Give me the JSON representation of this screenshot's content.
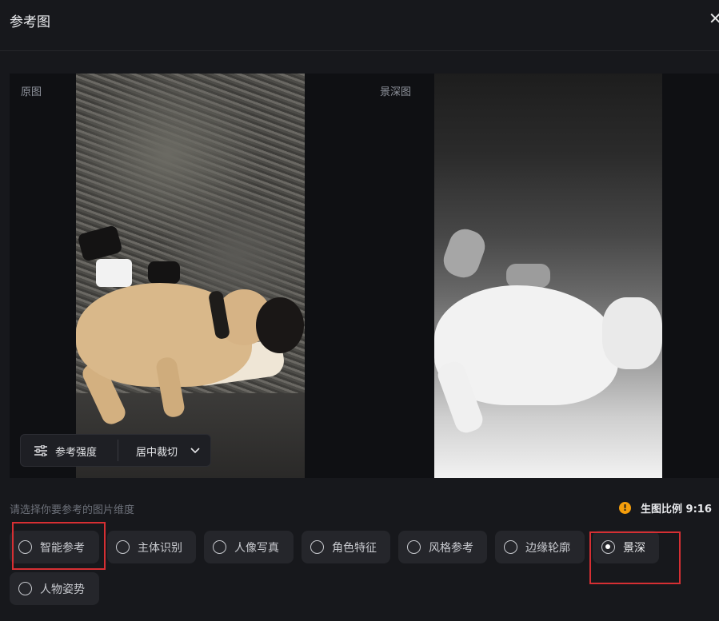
{
  "header": {
    "title": "参考图",
    "close_symbol": "✕"
  },
  "preview": {
    "original_label": "原图",
    "depth_label": "景深图",
    "controls": {
      "strength_label": "参考强度",
      "crop_label": "居中裁切"
    }
  },
  "dimension": {
    "prompt": "请选择你要参考的图片维度",
    "ratio_text": "生图比例 9:16",
    "ratio_icon": "!",
    "options": [
      {
        "label": "智能参考",
        "checked": false
      },
      {
        "label": "主体识别",
        "checked": false
      },
      {
        "label": "人像写真",
        "checked": false
      },
      {
        "label": "角色特征",
        "checked": false
      },
      {
        "label": "风格参考",
        "checked": false
      },
      {
        "label": "边缘轮廓",
        "checked": false
      },
      {
        "label": "景深",
        "checked": true
      },
      {
        "label": "人物姿势",
        "checked": false
      }
    ]
  },
  "colors": {
    "background": "#17181c",
    "option_bg": "#25262b",
    "warning": "#f59e0b",
    "highlight": "#d62f33"
  }
}
